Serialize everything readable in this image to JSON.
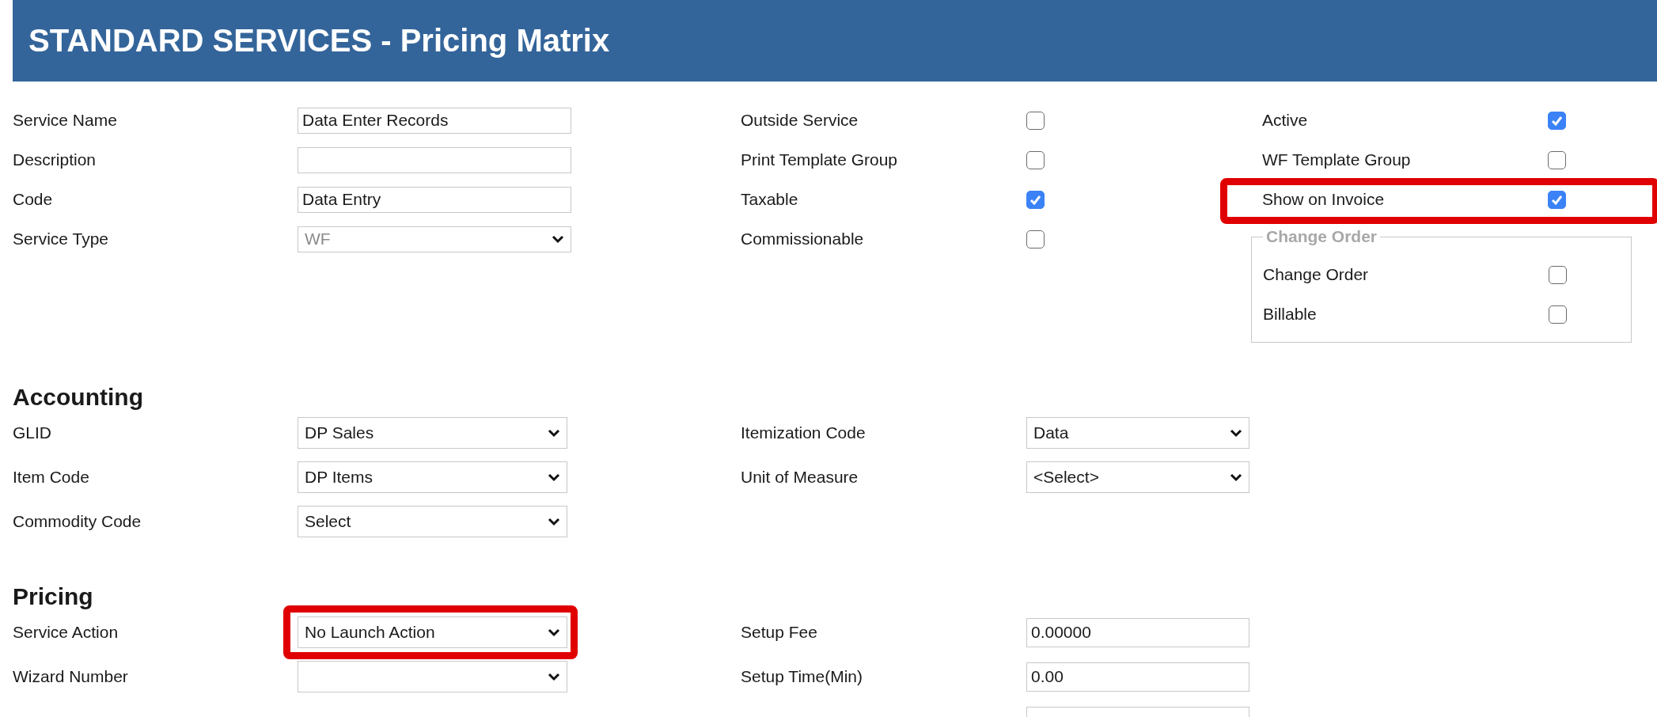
{
  "header": {
    "title": "STANDARD SERVICES - Pricing Matrix"
  },
  "general": {
    "fields": [
      {
        "label": "Service Name",
        "kind": "text",
        "value": "Data Enter Records",
        "disabled": false
      },
      {
        "label": "Description",
        "kind": "text",
        "disabled": false
      },
      {
        "label": "Code",
        "kind": "text",
        "value": "Data Entry",
        "disabled": false
      },
      {
        "label": "Service Type",
        "kind": "select",
        "value": "WF",
        "disabled": true
      }
    ],
    "flags": [
      {
        "label": "Outside Service",
        "checked": false
      },
      {
        "label": "Print Template Group",
        "checked": false
      },
      {
        "label": "Taxable",
        "checked": true
      },
      {
        "label": "Commissionable",
        "checked": false
      }
    ],
    "options": [
      {
        "label": "Active",
        "checked": true,
        "highlighted": false
      },
      {
        "label": "WF Template Group",
        "checked": false,
        "highlighted": false
      },
      {
        "label": "Show on Invoice",
        "checked": true,
        "highlighted": true
      }
    ],
    "change_order": {
      "legend": "Change Order",
      "items": [
        {
          "label": "Change Order",
          "checked": false
        },
        {
          "label": "Billable",
          "checked": false
        }
      ]
    }
  },
  "accounting": {
    "heading": "Accounting",
    "left": [
      {
        "label": "GLID",
        "kind": "select",
        "value": "DP Sales",
        "highlighted": false
      },
      {
        "label": "Item Code",
        "kind": "select",
        "value": "DP Items",
        "highlighted": false
      },
      {
        "label": "Commodity Code",
        "kind": "select",
        "value": "Select",
        "highlighted": false
      }
    ],
    "right": [
      {
        "label": "Itemization Code",
        "kind": "select",
        "value": "Data"
      },
      {
        "label": "Unit of Measure",
        "kind": "select",
        "value": "<Select>"
      }
    ]
  },
  "pricing": {
    "heading": "Pricing",
    "left": [
      {
        "label": "Service Action",
        "kind": "select",
        "value": "No Launch Action",
        "highlighted": true
      },
      {
        "label": "Wizard Number",
        "kind": "select",
        "highlighted": false
      }
    ],
    "right": [
      {
        "label": "Setup Fee",
        "kind": "text",
        "value": "0.00000"
      },
      {
        "label": "Setup Time(Min)",
        "kind": "text",
        "value": "0.00"
      },
      {
        "kind": "text"
      }
    ]
  }
}
